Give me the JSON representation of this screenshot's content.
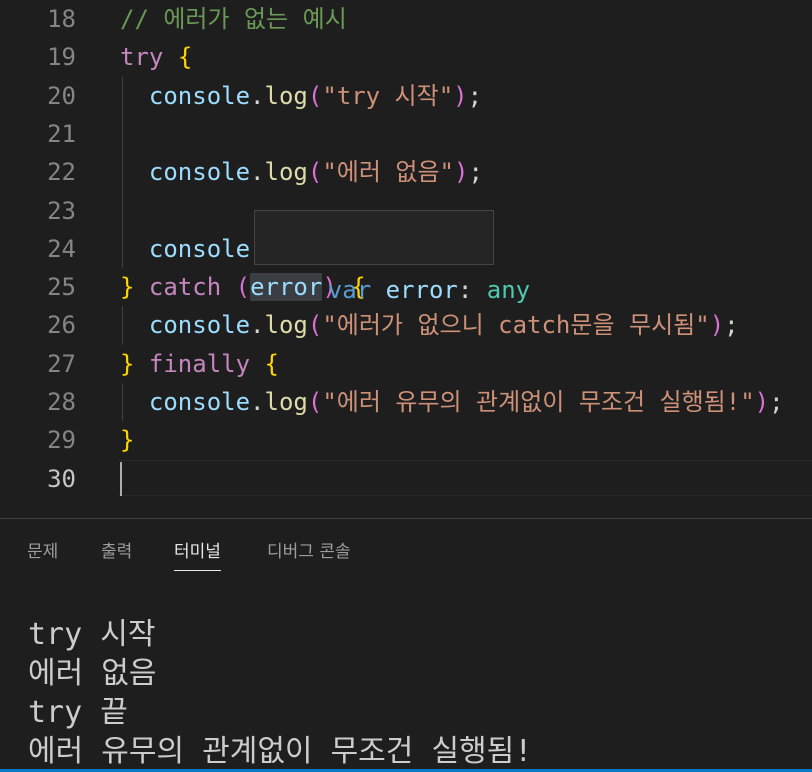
{
  "editor": {
    "lines": [
      {
        "num": "18",
        "tokens": [
          {
            "t": "// 에러가 없는 예시",
            "c": "cmt"
          }
        ]
      },
      {
        "num": "19",
        "tokens": [
          {
            "t": "try",
            "c": "kw"
          },
          {
            "t": " ",
            "c": "pn"
          },
          {
            "t": "{",
            "c": "br1"
          }
        ]
      },
      {
        "num": "20",
        "tokens": [
          {
            "t": "  console",
            "c": "var"
          },
          {
            "t": ".",
            "c": "pn"
          },
          {
            "t": "log",
            "c": "fn"
          },
          {
            "t": "(",
            "c": "br2"
          },
          {
            "t": "\"try 시작\"",
            "c": "str"
          },
          {
            "t": ")",
            "c": "br2"
          },
          {
            "t": ";",
            "c": "pn"
          }
        ]
      },
      {
        "num": "21",
        "tokens": []
      },
      {
        "num": "22",
        "tokens": [
          {
            "t": "  console",
            "c": "var"
          },
          {
            "t": ".",
            "c": "pn"
          },
          {
            "t": "log",
            "c": "fn"
          },
          {
            "t": "(",
            "c": "br2"
          },
          {
            "t": "\"에러 없음\"",
            "c": "str"
          },
          {
            "t": ")",
            "c": "br2"
          },
          {
            "t": ";",
            "c": "pn"
          }
        ]
      },
      {
        "num": "23",
        "tokens": []
      },
      {
        "num": "24",
        "tokens": [
          {
            "t": "  console",
            "c": "var"
          }
        ]
      },
      {
        "num": "25",
        "tokens": [
          {
            "t": "}",
            "c": "br1"
          },
          {
            "t": " ",
            "c": "pn"
          },
          {
            "t": "catch",
            "c": "kw"
          },
          {
            "t": " ",
            "c": "pn"
          },
          {
            "t": "(",
            "c": "br2"
          },
          {
            "t": "error",
            "c": "var hl-word"
          },
          {
            "t": ")",
            "c": "br2"
          },
          {
            "t": " ",
            "c": "pn"
          },
          {
            "t": "{",
            "c": "br1"
          }
        ]
      },
      {
        "num": "26",
        "tokens": [
          {
            "t": "  console",
            "c": "var"
          },
          {
            "t": ".",
            "c": "pn"
          },
          {
            "t": "log",
            "c": "fn"
          },
          {
            "t": "(",
            "c": "br2"
          },
          {
            "t": "\"에러가 없으니 catch문을 무시됨\"",
            "c": "str"
          },
          {
            "t": ")",
            "c": "br2"
          },
          {
            "t": ";",
            "c": "pn"
          }
        ]
      },
      {
        "num": "27",
        "tokens": [
          {
            "t": "}",
            "c": "br1"
          },
          {
            "t": " ",
            "c": "pn"
          },
          {
            "t": "finally",
            "c": "kw"
          },
          {
            "t": " ",
            "c": "pn"
          },
          {
            "t": "{",
            "c": "br1"
          }
        ]
      },
      {
        "num": "28",
        "tokens": [
          {
            "t": "  console",
            "c": "var"
          },
          {
            "t": ".",
            "c": "pn"
          },
          {
            "t": "log",
            "c": "fn"
          },
          {
            "t": "(",
            "c": "br2"
          },
          {
            "t": "\"에러 유무의 관계없이 무조건 실행됨!\"",
            "c": "str"
          },
          {
            "t": ")",
            "c": "br2"
          },
          {
            "t": ";",
            "c": "pn"
          }
        ]
      },
      {
        "num": "29",
        "tokens": [
          {
            "t": "}",
            "c": "br1"
          }
        ]
      },
      {
        "num": "30",
        "tokens": []
      }
    ],
    "active_line": "30"
  },
  "hover": {
    "keyword": "var",
    "name": " error",
    "colon": ": ",
    "type": "any"
  },
  "panel": {
    "tabs": [
      {
        "label": "문제"
      },
      {
        "label": "출력"
      },
      {
        "label": "터미널"
      },
      {
        "label": "디버그 콘솔"
      }
    ],
    "active_tab": "터미널",
    "terminal_lines": [
      "try 시작",
      "에러 없음",
      "try 끝",
      "에러 유무의 관계없이 무조건 실행됨!"
    ]
  },
  "colors": {
    "background": "#1e1e1e",
    "keyword": "#c586c0",
    "string": "#ce9178",
    "comment": "#6a9955",
    "variable": "#9cdcfe",
    "function": "#dcdcaa",
    "bracket_gold": "#ffd700",
    "bracket_orchid": "#da70d6",
    "type": "#4ec9b0"
  }
}
